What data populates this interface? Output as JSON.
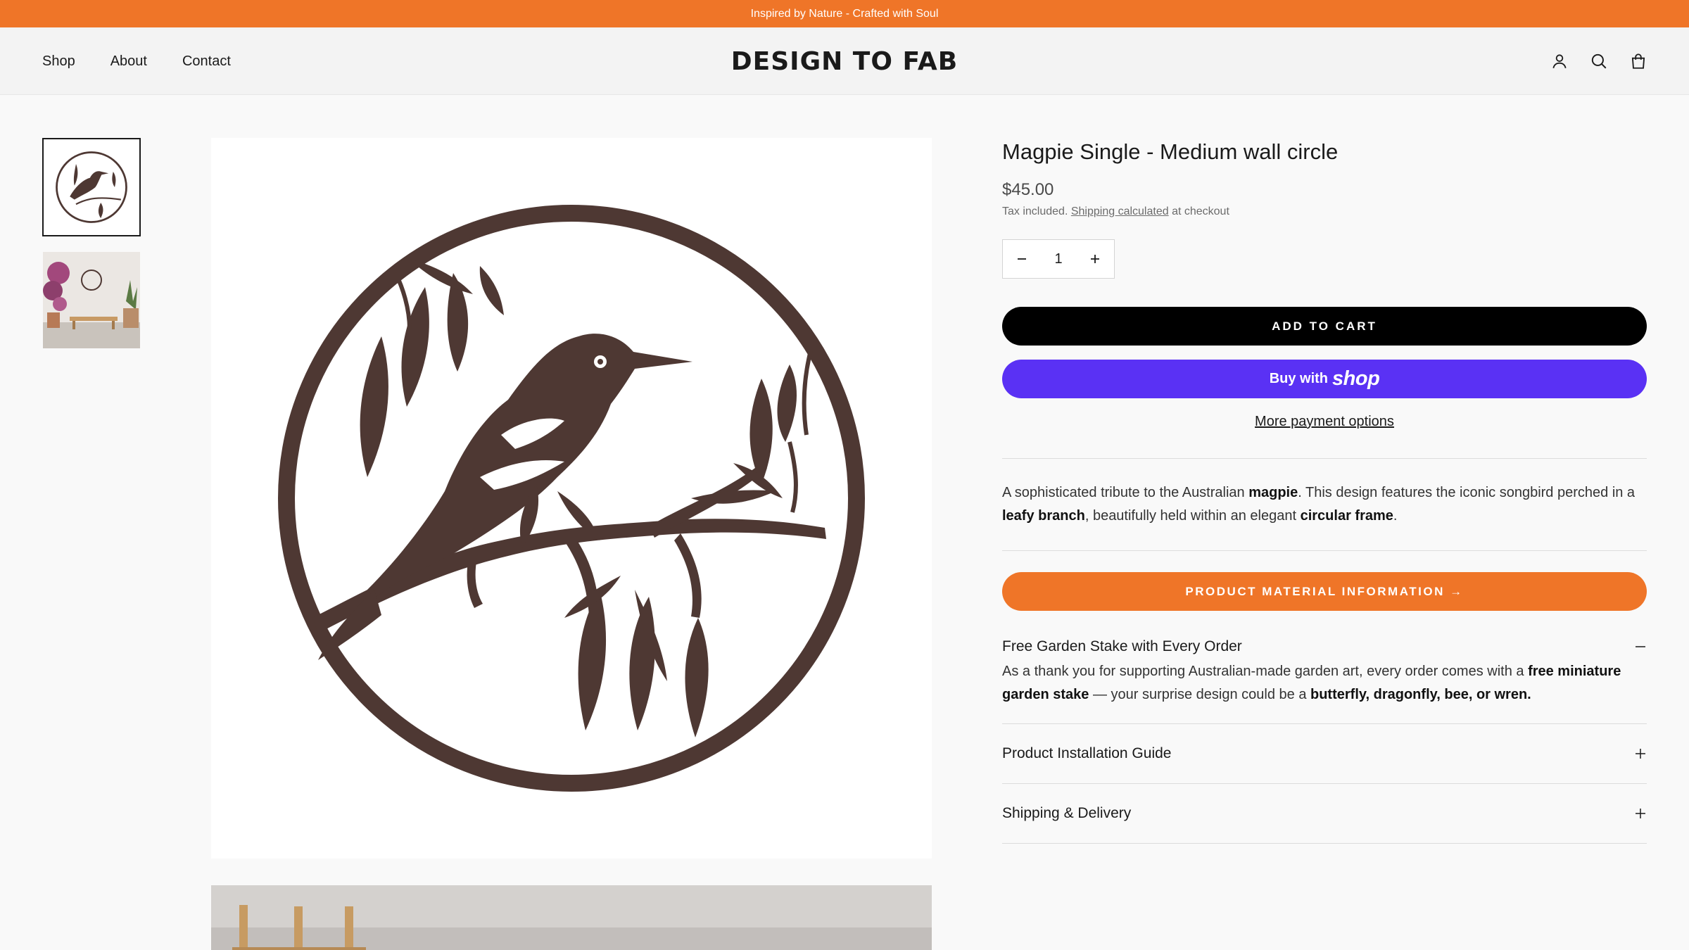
{
  "announcement": "Inspired by Nature - Crafted with Soul",
  "nav": {
    "shop": "Shop",
    "about": "About",
    "contact": "Contact"
  },
  "logo": "DESIGN TO FAB",
  "header_icons": [
    "account-icon",
    "search-icon",
    "cart-icon"
  ],
  "product": {
    "title": "Magpie Single - Medium wall circle",
    "price": "$45.00",
    "tax_prefix": "Tax included.",
    "tax_link": "Shipping calculated",
    "tax_suffix": "at checkout",
    "quantity": "1",
    "add_to_cart": "ADD TO CART",
    "buy_with": "Buy with",
    "shop_word": "shop",
    "more_payment": "More payment options",
    "description": {
      "p1": "A sophisticated tribute to the Australian ",
      "b1": "magpie",
      "p2": ". This design features the iconic songbird perched in a ",
      "b2": "leafy branch",
      "p3": ", beautifully held within an elegant ",
      "b3": "circular frame",
      "p4": "."
    },
    "material_button": "PRODUCT MATERIAL INFORMATION →"
  },
  "accordion": {
    "stake": {
      "title": "Free Garden Stake with Every Order",
      "toggle": "−",
      "body_p1": "As a thank you for supporting Australian-made garden art, every order comes with a ",
      "body_b1": "free miniature garden stake",
      "body_p2": " — your surprise design could be a ",
      "body_b2": "butterfly, dragonfly, bee, or wren."
    },
    "install": {
      "title": "Product Installation Guide",
      "toggle": "+"
    },
    "shipping": {
      "title": "Shipping & Delivery",
      "toggle": "+"
    }
  },
  "colors": {
    "accent": "#ef7528",
    "shop_pay": "#5a31f4",
    "metal": "#4e3833"
  }
}
